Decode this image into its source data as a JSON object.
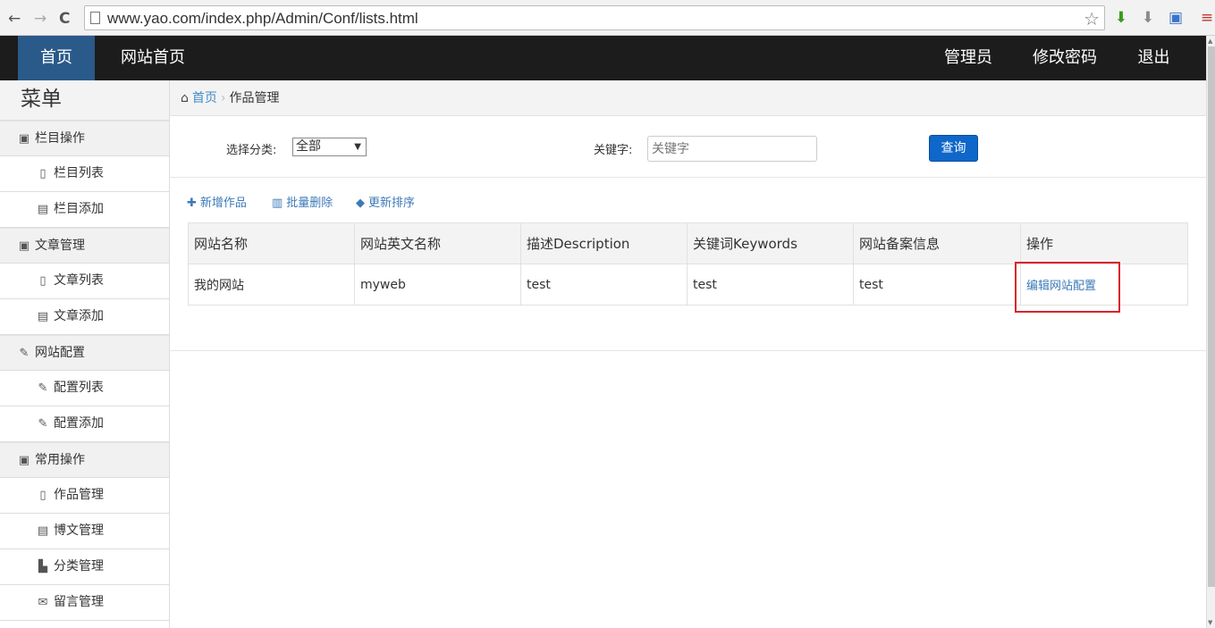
{
  "browser": {
    "url": "www.yao.com/index.php/Admin/Conf/lists.html",
    "back_glyph": "←",
    "forward_glyph": "→",
    "reload_glyph": "C",
    "star_glyph": "☆"
  },
  "topbar": {
    "home": "首页",
    "site_home": "网站首页",
    "admin": "管理员",
    "change_password": "修改密码",
    "logout": "退出"
  },
  "sidebar": {
    "title": "菜单",
    "groups": [
      {
        "label": "栏目操作",
        "icon": "book-icon",
        "items": [
          {
            "label": "栏目列表",
            "icon": "file-icon"
          },
          {
            "label": "栏目添加",
            "icon": "list-icon"
          }
        ]
      },
      {
        "label": "文章管理",
        "icon": "book-icon",
        "items": [
          {
            "label": "文章列表",
            "icon": "file-icon"
          },
          {
            "label": "文章添加",
            "icon": "list-icon"
          }
        ]
      },
      {
        "label": "网站配置",
        "icon": "wrench-icon",
        "items": [
          {
            "label": "配置列表",
            "icon": "wrench-icon"
          },
          {
            "label": "配置添加",
            "icon": "wrench-icon"
          }
        ]
      },
      {
        "label": "常用操作",
        "icon": "book-icon",
        "items": [
          {
            "label": "作品管理",
            "icon": "file-icon"
          },
          {
            "label": "博文管理",
            "icon": "list-icon"
          },
          {
            "label": "分类管理",
            "icon": "road-icon"
          },
          {
            "label": "留言管理",
            "icon": "envelope-icon"
          }
        ]
      }
    ]
  },
  "breadcrumb": {
    "home": "首页",
    "current": "作品管理"
  },
  "filter": {
    "category_label": "选择分类:",
    "category_value": "全部",
    "keyword_label": "关键字:",
    "keyword_placeholder": "关键字",
    "query_button": "查询"
  },
  "actions": {
    "add": "新增作品",
    "batch_delete": "批量删除",
    "update_sort": "更新排序"
  },
  "table": {
    "headers": [
      "网站名称",
      "网站英文名称",
      "描述Description",
      "关键词Keywords",
      "网站备案信息",
      "操作"
    ],
    "rows": [
      {
        "name": "我的网站",
        "en_name": "myweb",
        "description": "test",
        "keywords": "test",
        "icp": "test",
        "action": "编辑网站配置"
      }
    ]
  },
  "colors": {
    "topbar_bg": "#1c1c1c",
    "active_nav_bg": "#2a5a8a",
    "link": "#3c7ab8",
    "button": "#0e67c9",
    "highlight": "#d9232b"
  }
}
